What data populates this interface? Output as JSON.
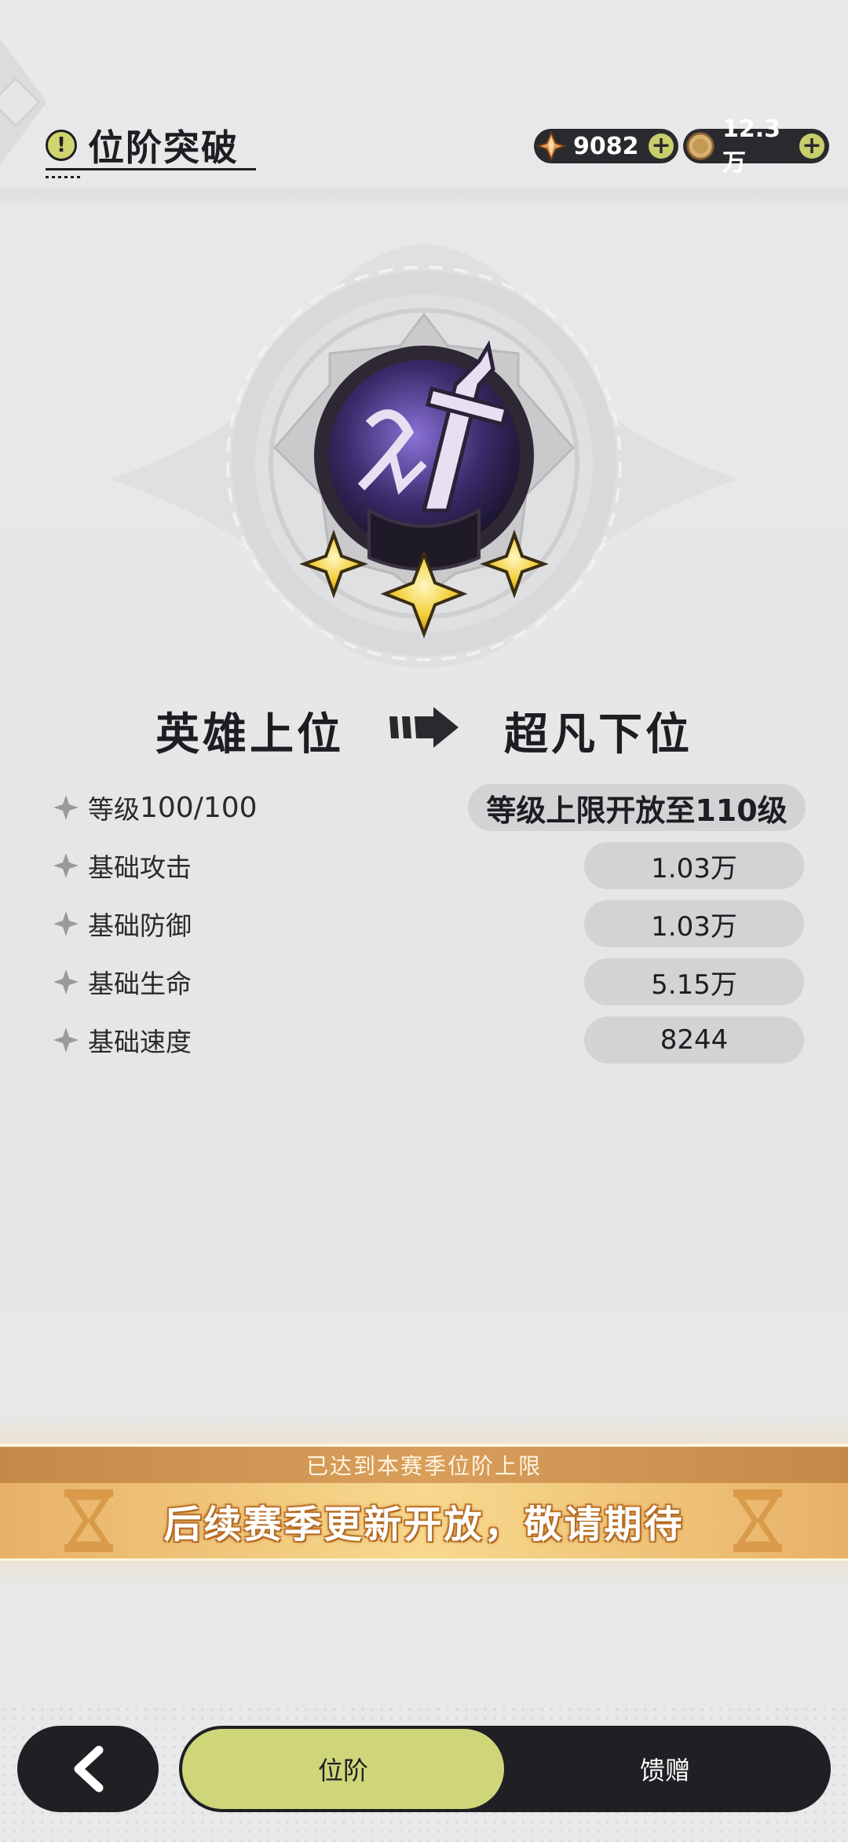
{
  "header": {
    "title": "位阶突破",
    "currency1": {
      "value": "9082",
      "icon": "crystal-icon"
    },
    "currency2": {
      "value": "12.3万",
      "icon": "coin-icon"
    },
    "plus": "+"
  },
  "rank": {
    "current": "英雄上位",
    "next": "超凡下位",
    "stars": 3
  },
  "stats": {
    "level_label": "等级",
    "level_value": "100/100",
    "level_unlock": "等级上限开放至110级",
    "rows": [
      {
        "label": "基础攻击",
        "value": "1.03万"
      },
      {
        "label": "基础防御",
        "value": "1.03万"
      },
      {
        "label": "基础生命",
        "value": "5.15万"
      },
      {
        "label": "基础速度",
        "value": "8244"
      }
    ]
  },
  "banner": {
    "top": "已达到本赛季位阶上限",
    "main": "后续赛季更新开放，敬请期待"
  },
  "nav": {
    "tab_rank": "位阶",
    "tab_gift": "馈赠"
  },
  "colors": {
    "accent": "#cfd67a",
    "dark": "#1f1f24",
    "banner": "#e8b168"
  }
}
